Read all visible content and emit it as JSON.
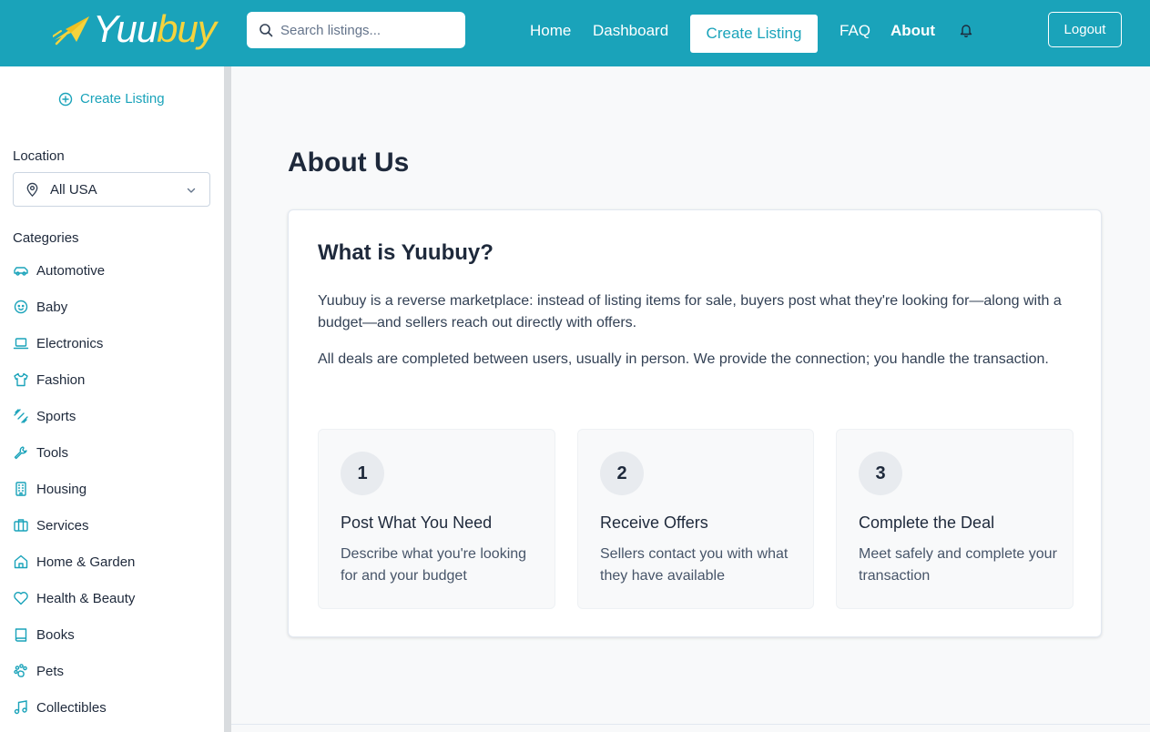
{
  "header": {
    "logo_part1": "Yuu",
    "logo_part2": "buy",
    "search_placeholder": "Search listings...",
    "nav": {
      "home": "Home",
      "dashboard": "Dashboard",
      "create_listing": "Create Listing",
      "faq": "FAQ",
      "about": "About"
    },
    "logout": "Logout"
  },
  "sidebar": {
    "create_listing": "Create Listing",
    "location_label": "Location",
    "location_value": "All USA",
    "categories_label": "Categories",
    "categories": [
      {
        "label": "Automotive",
        "icon": "car-icon"
      },
      {
        "label": "Baby",
        "icon": "baby-icon"
      },
      {
        "label": "Electronics",
        "icon": "laptop-icon"
      },
      {
        "label": "Fashion",
        "icon": "shirt-icon"
      },
      {
        "label": "Sports",
        "icon": "dumbbell-icon"
      },
      {
        "label": "Tools",
        "icon": "wrench-icon"
      },
      {
        "label": "Housing",
        "icon": "building-icon"
      },
      {
        "label": "Services",
        "icon": "briefcase-icon"
      },
      {
        "label": "Home & Garden",
        "icon": "house-icon"
      },
      {
        "label": "Health & Beauty",
        "icon": "heart-icon"
      },
      {
        "label": "Books",
        "icon": "book-icon"
      },
      {
        "label": "Pets",
        "icon": "paw-icon"
      },
      {
        "label": "Collectibles",
        "icon": "music-icon"
      }
    ]
  },
  "main": {
    "title": "About Us",
    "card": {
      "title": "What is Yuubuy?",
      "paragraphs": [
        "Yuubuy is a reverse marketplace: instead of listing items for sale, buyers post what they're looking for—along with a budget—and sellers reach out directly with offers.",
        "All deals are completed between users, usually in person. We provide the connection; you handle the transaction."
      ],
      "steps": [
        {
          "number": "1",
          "title": "Post What You Need",
          "desc": "Describe what you're looking for and your budget"
        },
        {
          "number": "2",
          "title": "Receive Offers",
          "desc": "Sellers contact you with what they have available"
        },
        {
          "number": "3",
          "title": "Complete the Deal",
          "desc": "Meet safely and complete your transaction"
        }
      ]
    }
  },
  "colors": {
    "brand": "#1aa3ba",
    "logo_accent": "#f5d33d",
    "text": "#1e293b"
  }
}
